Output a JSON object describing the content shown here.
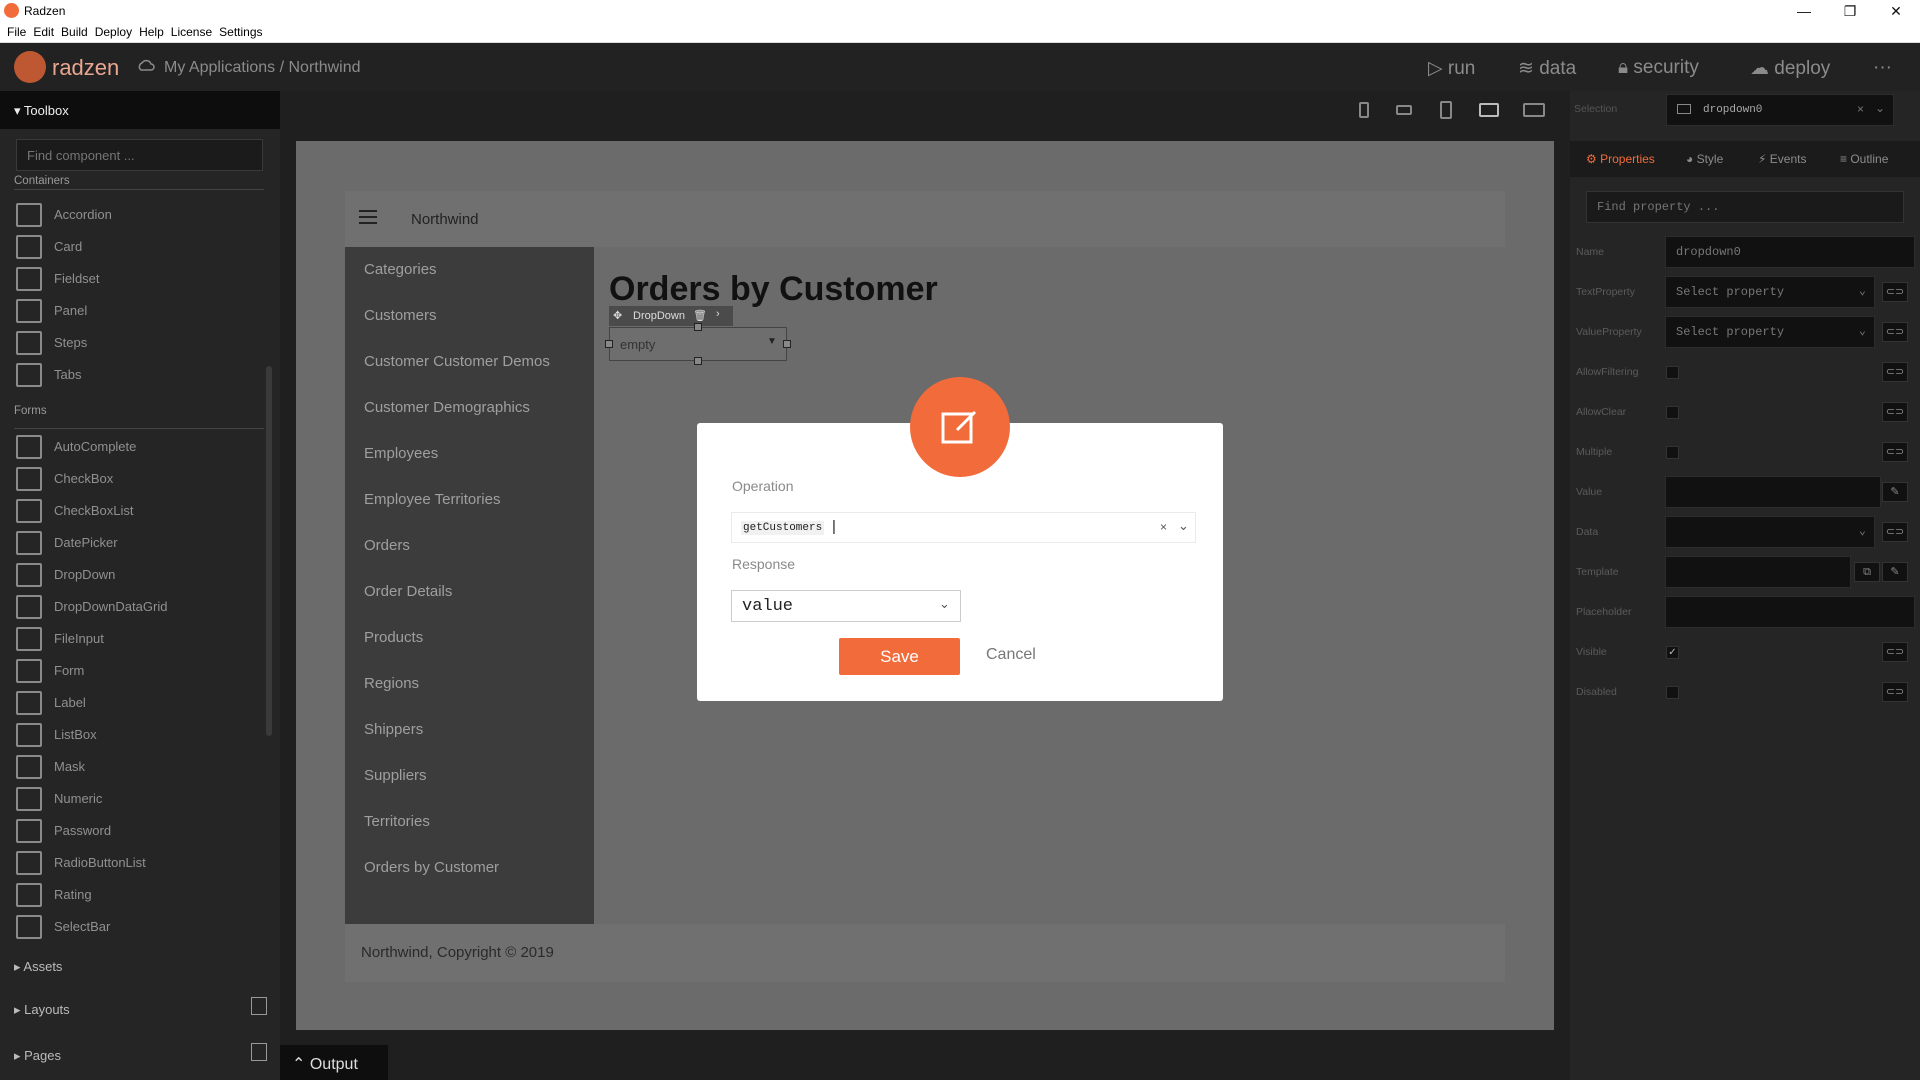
{
  "window": {
    "title": "Radzen",
    "controls": [
      "—",
      "❐",
      "✕"
    ]
  },
  "menu": [
    "File",
    "Edit",
    "Build",
    "Deploy",
    "Help",
    "License",
    "Settings"
  ],
  "topbar": {
    "brand": "radzen",
    "breadcrumb": "My Applications / Northwind",
    "actions": {
      "run": "run",
      "data": "data",
      "security": "security",
      "deploy": "deploy",
      "more": "···"
    }
  },
  "toolbox": {
    "title": "Toolbox",
    "search_placeholder": "Find component ...",
    "sections": {
      "containers": "Containers",
      "forms": "Forms"
    },
    "containers": [
      "Accordion",
      "Card",
      "Fieldset",
      "Panel",
      "Steps",
      "Tabs"
    ],
    "forms": [
      "AutoComplete",
      "CheckBox",
      "CheckBoxList",
      "DatePicker",
      "DropDown",
      "DropDownDataGrid",
      "FileInput",
      "Form",
      "Label",
      "ListBox",
      "Mask",
      "Numeric",
      "Password",
      "RadioButtonList",
      "Rating",
      "SelectBar"
    ],
    "folds": {
      "assets": "Assets",
      "layouts": "Layouts",
      "pages": "Pages"
    }
  },
  "app": {
    "header_title": "Northwind",
    "nav": [
      "Categories",
      "Customers",
      "Customer Customer Demos",
      "Customer Demographics",
      "Employees",
      "Employee Territories",
      "Orders",
      "Order Details",
      "Products",
      "Regions",
      "Shippers",
      "Suppliers",
      "Territories",
      "Orders by Customer"
    ],
    "page_title": "Orders by Customer",
    "footer": "Northwind, Copyright © 2019",
    "dropdown_component": {
      "label": "DropDown",
      "value": "empty"
    }
  },
  "dialog": {
    "operation_label": "Operation",
    "operation_value": "getCustomers",
    "response_label": "Response",
    "response_value": "value",
    "save": "Save",
    "cancel": "Cancel"
  },
  "properties": {
    "selection_label": "Selection",
    "selection_value": "dropdown0",
    "tabs": [
      "Properties",
      "Style",
      "Events",
      "Outline"
    ],
    "search_placeholder": "Find property ...",
    "rows": {
      "name": {
        "label": "Name",
        "value": "dropdown0"
      },
      "text_property": {
        "label": "TextProperty",
        "value": "Select property"
      },
      "value_property": {
        "label": "ValueProperty",
        "value": "Select property"
      },
      "allow_filtering": {
        "label": "AllowFiltering"
      },
      "allow_clear": {
        "label": "AllowClear"
      },
      "multiple": {
        "label": "Multiple"
      },
      "value": {
        "label": "Value"
      },
      "data": {
        "label": "Data"
      },
      "template": {
        "label": "Template"
      },
      "placeholder": {
        "label": "Placeholder"
      },
      "visible": {
        "label": "Visible",
        "checked": true
      },
      "disabled": {
        "label": "Disabled"
      }
    }
  },
  "output": {
    "label": "Output"
  },
  "colors": {
    "accent": "#f26b3a"
  }
}
